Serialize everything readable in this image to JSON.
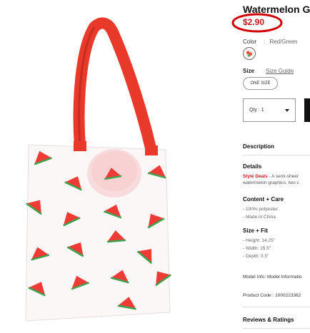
{
  "product": {
    "title": "Watermelon Gr",
    "price": "$2.90"
  },
  "color": {
    "label": "Color",
    "separator": ":",
    "value": "Red/Green"
  },
  "size": {
    "label": "Size",
    "guide_link": "Size Guide",
    "option": "ONE SIZE"
  },
  "quantity": {
    "value": "Qty : 1"
  },
  "sections": {
    "description": "Description",
    "details": "Details",
    "details_deal": "Style Deals",
    "details_text_1": " - A semi-sheer",
    "details_text_2": "watermelon graphics, two c",
    "content_care": "Content + Care",
    "content_items": [
      "- 100% polyester",
      "- Made in China"
    ],
    "size_fit": "Size + Fit",
    "size_items": [
      "- Height: 14.25\"",
      "- Width: 15.5\"",
      "- Depth: 0.5\""
    ],
    "model_info": "Model Info: Model Informatio",
    "product_code": "Product Code : 1000223362",
    "reviews": "Reviews & Ratings"
  },
  "accent": {
    "price_red": "#c4161c",
    "annotation_circle": "#d10000",
    "strap_red": "#e8392b"
  }
}
